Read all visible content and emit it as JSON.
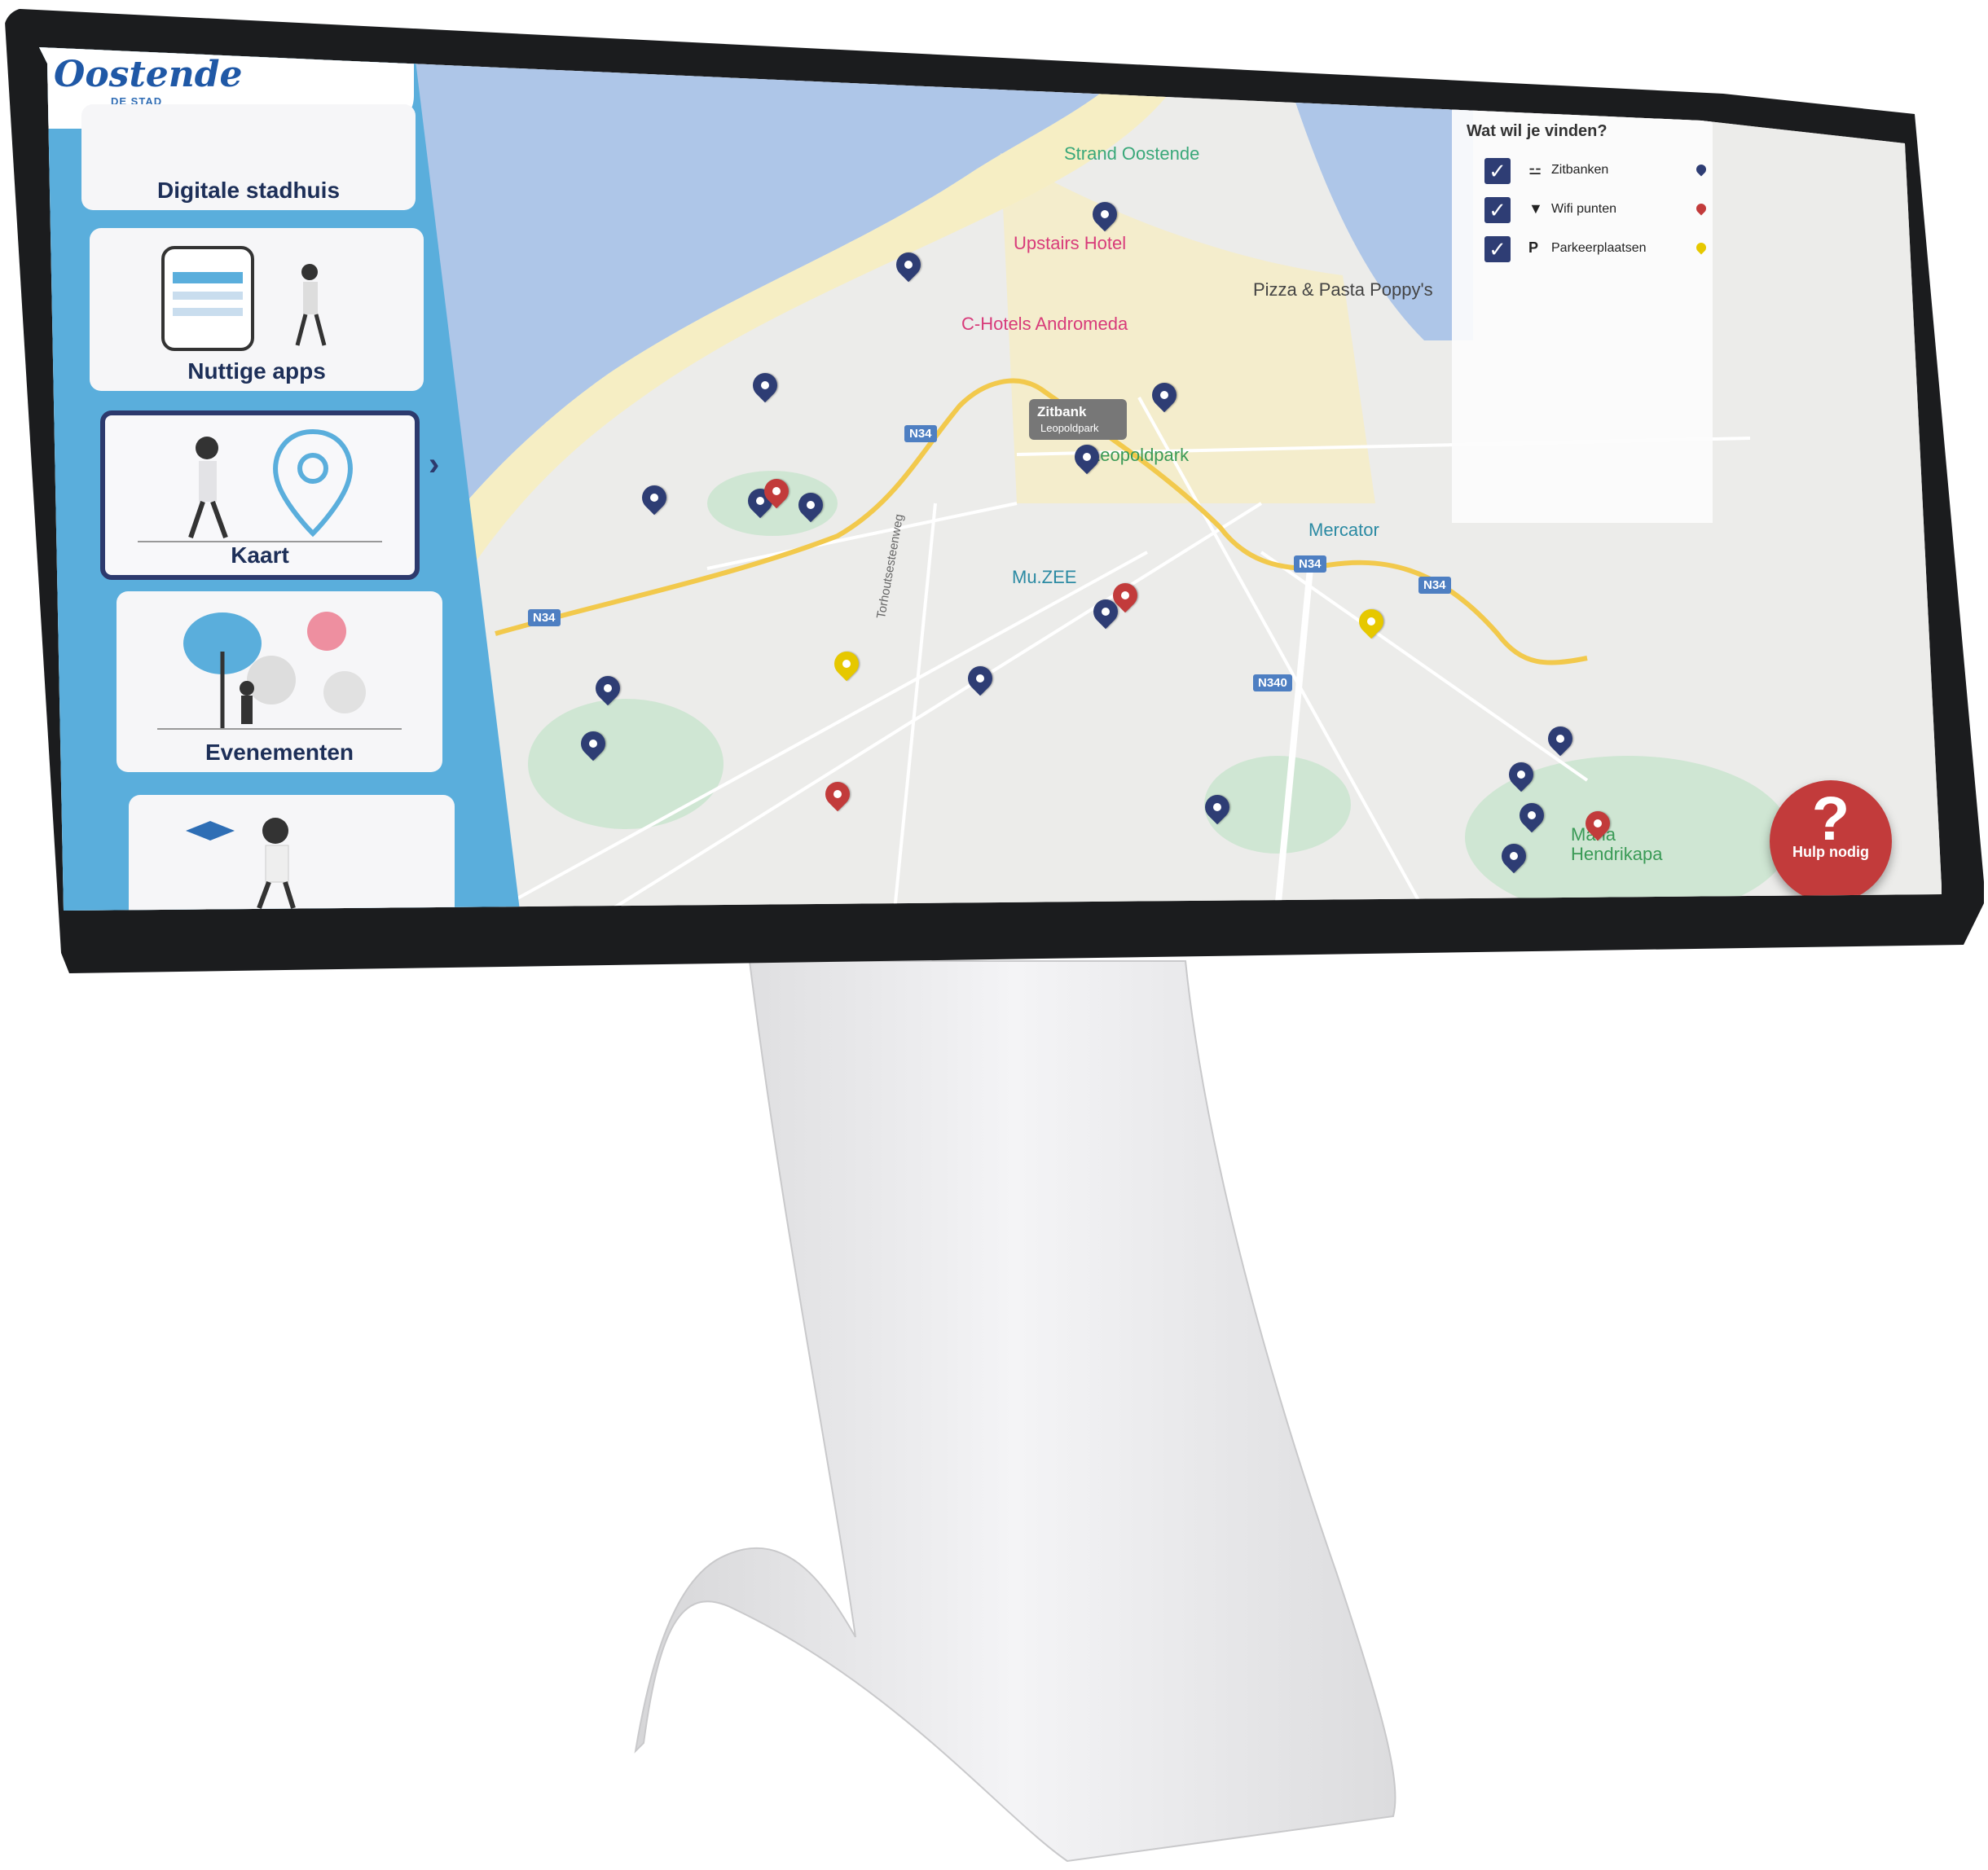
{
  "sidebar": {
    "logo_word": "Oostende",
    "logo_sub": "DE STAD AAN ZEE",
    "cards": [
      {
        "label": "Digitale stadhuis"
      },
      {
        "label": "Nuttige apps"
      },
      {
        "label": "Kaart"
      },
      {
        "label": "Evenementen"
      }
    ]
  },
  "filter": {
    "title": "Wat wil je vinden?",
    "items": [
      {
        "label": "Zitbanken",
        "icon": "bench-icon",
        "pin_color": "#2e3d74",
        "checked": true
      },
      {
        "label": "Wifi punten",
        "icon": "wifi-icon",
        "pin_color": "#c23b3b",
        "checked": true
      },
      {
        "label": "Parkeerplaatsen",
        "icon": "P",
        "pin_color": "#e6c800",
        "checked": true
      }
    ]
  },
  "tooltip": {
    "title": "Zitbank",
    "subtitle": "Leopoldpark"
  },
  "places": {
    "strand": "Strand Oostende",
    "upstairs": "Upstairs Hotel",
    "pizza": "Pizza & Pasta Poppy's",
    "chotels": "C-Hotels Andromeda",
    "leopold": "Leopoldpark",
    "mercator": "Mercator",
    "muzee": "Mu.ZEE",
    "maria": "Maria Hendrikapa",
    "torhout": "Torhoutsesteenweg"
  },
  "roads": {
    "n34": "N34",
    "n340": "N340"
  },
  "help": {
    "label": "Hulp nodig",
    "glyph": "?"
  },
  "colors": {
    "sea": "#aec6e8",
    "beach": "#f6eec4",
    "park": "#cfe6d3",
    "sidebar": "#5aaedc",
    "pin_blue": "#2e3d74",
    "pin_red": "#c23b3b",
    "pin_yellow": "#e6c800"
  }
}
